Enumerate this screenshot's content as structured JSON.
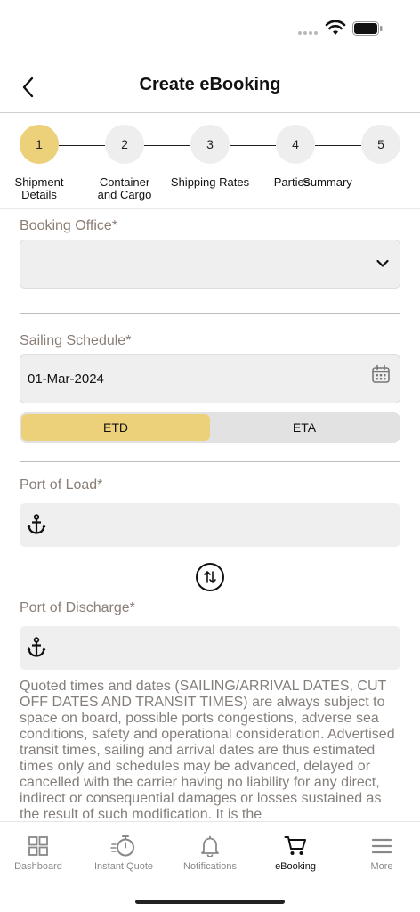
{
  "header": {
    "title": "Create eBooking"
  },
  "stepper": {
    "steps": [
      {
        "number": "1",
        "label": "Shipment Details"
      },
      {
        "number": "2",
        "label": "Container and Cargo"
      },
      {
        "number": "3",
        "label": "Shipping Rates"
      },
      {
        "number": "4",
        "label": "Parties"
      },
      {
        "number": "5",
        "label": "Summary"
      }
    ],
    "current_step": 1
  },
  "booking_office": {
    "label": "Booking Office*",
    "value": ""
  },
  "sailing_schedule": {
    "label": "Sailing Schedule*",
    "date_value": "01-Mar-2024",
    "toggle_options": [
      "ETD",
      "ETA"
    ],
    "selected": "ETD"
  },
  "port_of_load": {
    "label": "Port of Load*",
    "value": ""
  },
  "port_of_discharge": {
    "label": "Port of Discharge*",
    "value": ""
  },
  "disclaimer": "Quoted times and dates (SAILING/ARRIVAL DATES, CUT OFF DATES AND TRANSIT TIMES) are always subject to space on board, possible ports congestions, adverse sea conditions, safety and operational consideration. Advertised transit times, sailing and arrival dates are thus estimated times only and schedules may be advanced, delayed or cancelled with the carrier having no liability for any direct, indirect or consequential damages or losses sustained as the result of such modification. It is the",
  "tabbar": {
    "tabs": [
      {
        "label": "Dashboard",
        "icon": "grid-icon"
      },
      {
        "label": "Instant Quote",
        "icon": "stopwatch-icon"
      },
      {
        "label": "Notifications",
        "icon": "bell-icon"
      },
      {
        "label": "eBooking",
        "icon": "cart-icon"
      },
      {
        "label": "More",
        "icon": "menu-icon"
      }
    ],
    "active": "eBooking"
  },
  "colors": {
    "accent": "#ecd07a",
    "label_text": "#8a7d74",
    "field_bg": "#efefef"
  }
}
